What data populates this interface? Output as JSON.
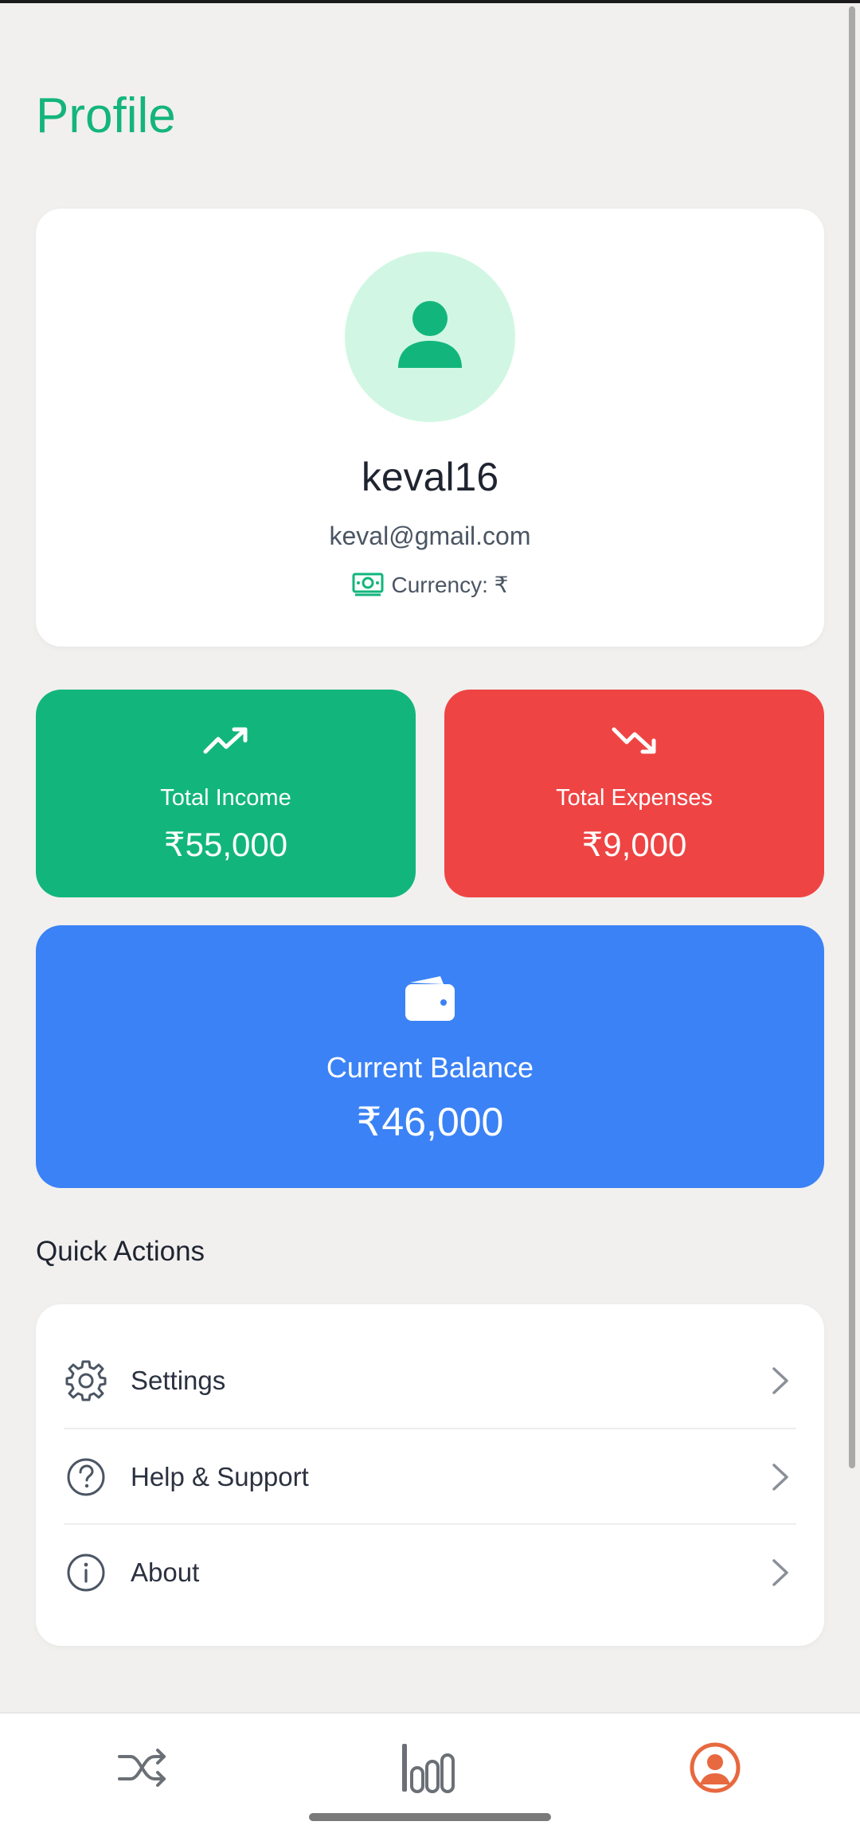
{
  "page": {
    "title": "Profile"
  },
  "profile": {
    "avatar_icon": "user-icon",
    "username": "keval16",
    "email": "keval@gmail.com",
    "currency_icon": "cash-icon",
    "currency_text": "Currency: ₹"
  },
  "stats": {
    "income": {
      "icon": "trending-up-icon",
      "label": "Total Income",
      "value": "₹55,000",
      "color": "#12b67c"
    },
    "expenses": {
      "icon": "trending-down-icon",
      "label": "Total Expenses",
      "value": "₹9,000",
      "color": "#ef4444"
    },
    "balance": {
      "icon": "wallet-icon",
      "label": "Current Balance",
      "value": "₹46,000",
      "color": "#3b82f6"
    }
  },
  "quick_actions": {
    "title": "Quick Actions",
    "items": [
      {
        "label": "Settings",
        "icon": "gear-icon"
      },
      {
        "label": "Help & Support",
        "icon": "help-circle-icon"
      },
      {
        "label": "About",
        "icon": "info-icon"
      }
    ]
  },
  "bottom_nav": {
    "items": [
      {
        "icon": "shuffle-icon",
        "active": false
      },
      {
        "icon": "bar-chart-icon",
        "active": false
      },
      {
        "icon": "profile-icon",
        "active": true
      }
    ],
    "active_color": "#e8683f"
  },
  "colors": {
    "accent": "#14b57c",
    "background": "#f1f0ee"
  }
}
